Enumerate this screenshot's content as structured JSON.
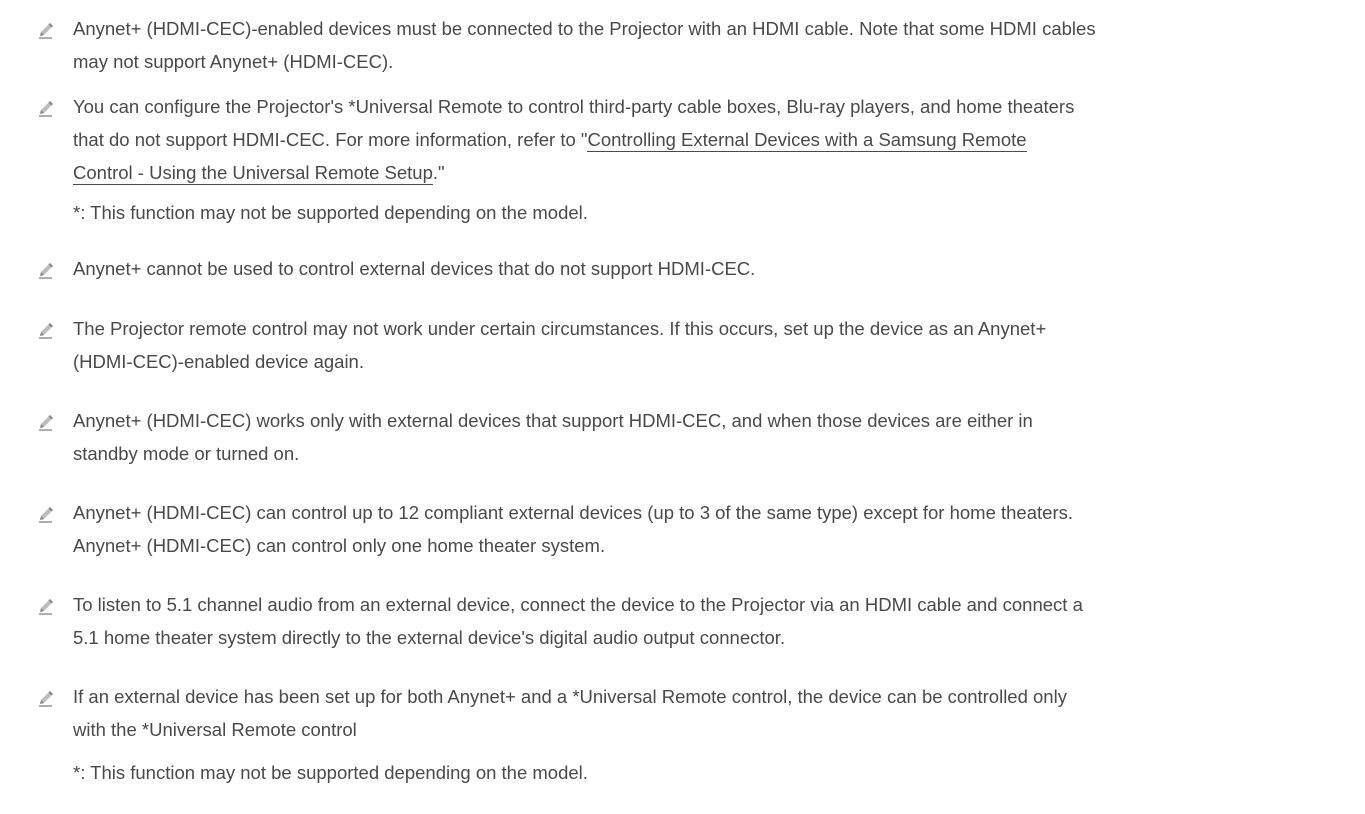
{
  "notes": [
    {
      "lines": [
        "Anynet+ (HDMI-CEC)-enabled devices must be connected to the Projector with an HDMI cable. Note that some HDMI cables",
        "may not support Anynet+ (HDMI-CEC)."
      ]
    },
    {
      "line1": "You can configure the Projector's *Universal Remote to control third-party cable boxes, Blu-ray players, and home theaters",
      "line2_prefix": "that do not support HDMI-CEC. For more information, refer to \"",
      "link_line1": "Controlling External Devices with a Samsung Remote",
      "link_line2": "Control - Using the Universal Remote Setup",
      "link_suffix": ".\"",
      "footnote": "*: This function may not be supported depending on the model."
    },
    {
      "lines": [
        "Anynet+ cannot be used to control external devices that do not support HDMI-CEC."
      ]
    },
    {
      "lines": [
        "The Projector remote control may not work under certain circumstances. If this occurs, set up the device as an Anynet+",
        "(HDMI-CEC)-enabled device again."
      ]
    },
    {
      "lines": [
        "Anynet+ (HDMI-CEC) works only with external devices that support HDMI-CEC, and when those devices are either in",
        "standby mode or turned on."
      ]
    },
    {
      "lines": [
        "Anynet+ (HDMI-CEC) can control up to 12 compliant external devices (up to 3 of the same type) except for home theaters.",
        "Anynet+ (HDMI-CEC) can control only one home theater system."
      ]
    },
    {
      "lines": [
        "To listen to 5.1 channel audio from an external device, connect the device to the Projector via an HDMI cable and connect a",
        "5.1 home theater system directly to the external device's digital audio output connector."
      ]
    },
    {
      "lines": [
        "If an external device has been set up for both Anynet+ and a *Universal Remote control, the device can be controlled only",
        "with the *Universal Remote control"
      ],
      "footnote": "*: This function may not be supported depending on the model."
    }
  ],
  "icon": "pencil-note-icon",
  "colors": {
    "text": "#4a4a4a",
    "icon_fill": "#8a8a8a",
    "icon_light": "#cfcfcf"
  }
}
